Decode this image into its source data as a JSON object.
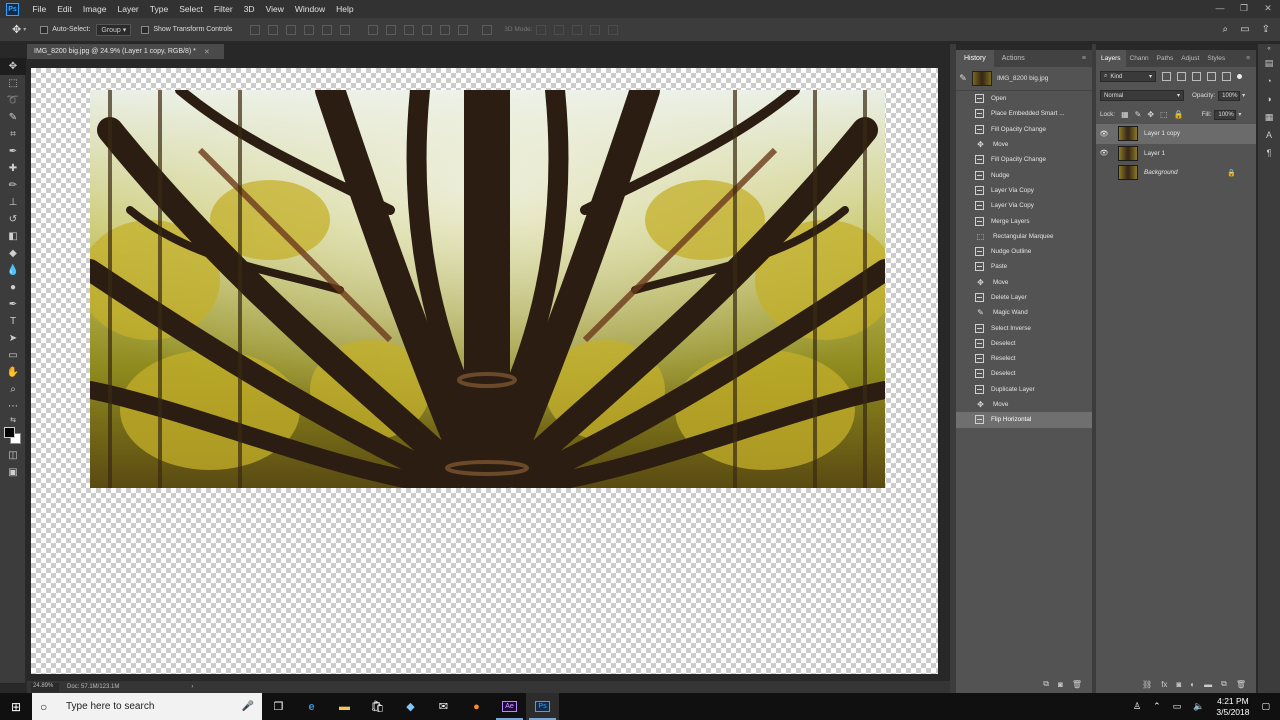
{
  "menubar": {
    "logo": "Ps",
    "items": [
      "File",
      "Edit",
      "Image",
      "Layer",
      "Type",
      "Select",
      "Filter",
      "3D",
      "View",
      "Window",
      "Help"
    ],
    "window_buttons": [
      "—",
      "❐",
      "✕"
    ]
  },
  "options_bar": {
    "auto_select_label": "Auto-Select:",
    "auto_select_target": "Group",
    "show_transform_label": "Show Transform Controls",
    "mode_3d_label": "3D Mode:"
  },
  "document": {
    "tab_title": "IMG_8200 big.jpg @ 24.9% (Layer 1 copy, RGB/8) *",
    "tab_close": "✕",
    "zoom": "24.89%",
    "doc_info": "Doc: 57.1M/123.1M",
    "status_arrow": "›"
  },
  "history_panel": {
    "tabs": [
      "History",
      "Actions"
    ],
    "menu_icon": "≡",
    "snapshot_name": "IMG_8200 big.jpg",
    "states": [
      {
        "label": "Open",
        "icon": "doc"
      },
      {
        "label": "Place Embedded Smart ...",
        "icon": "doc"
      },
      {
        "label": "Fill Opacity Change",
        "icon": "doc"
      },
      {
        "label": "Move",
        "icon": "move"
      },
      {
        "label": "Fill Opacity Change",
        "icon": "doc"
      },
      {
        "label": "Nudge",
        "icon": "doc"
      },
      {
        "label": "Layer Via Copy",
        "icon": "doc"
      },
      {
        "label": "Layer Via Copy",
        "icon": "doc"
      },
      {
        "label": "Merge Layers",
        "icon": "doc"
      },
      {
        "label": "Rectangular Marquee",
        "icon": "marquee"
      },
      {
        "label": "Nudge Outline",
        "icon": "doc"
      },
      {
        "label": "Paste",
        "icon": "doc"
      },
      {
        "label": "Move",
        "icon": "move"
      },
      {
        "label": "Delete Layer",
        "icon": "doc"
      },
      {
        "label": "Magic Wand",
        "icon": "wand"
      },
      {
        "label": "Select Inverse",
        "icon": "doc"
      },
      {
        "label": "Deselect",
        "icon": "doc"
      },
      {
        "label": "Reselect",
        "icon": "doc"
      },
      {
        "label": "Deselect",
        "icon": "doc"
      },
      {
        "label": "Duplicate Layer",
        "icon": "doc"
      },
      {
        "label": "Move",
        "icon": "move"
      },
      {
        "label": "Flip Horizontal",
        "icon": "doc"
      }
    ],
    "selected_index": 21
  },
  "layers_panel": {
    "tabs": [
      "Layers",
      "Chann",
      "Paths",
      "Adjust",
      "Styles"
    ],
    "menu_icon": "≡",
    "filter_kind": "Kind",
    "blend_mode": "Normal",
    "opacity_label": "Opacity:",
    "opacity_value": "100%",
    "lock_label": "Lock:",
    "fill_label": "Fill:",
    "fill_value": "100%",
    "layers": [
      {
        "name": "Layer 1 copy",
        "visible": true,
        "selected": true,
        "italic": false,
        "locked": false
      },
      {
        "name": "Layer 1",
        "visible": true,
        "selected": false,
        "italic": false,
        "locked": false
      },
      {
        "name": "Background",
        "visible": false,
        "selected": false,
        "italic": true,
        "locked": true
      }
    ]
  },
  "taskbar": {
    "search_placeholder": "Type here to search",
    "time": "4:21 PM",
    "date": "3/5/2018",
    "apps": [
      "task-view",
      "edge",
      "file-explorer",
      "store",
      "app",
      "mail",
      "firefox",
      "after-effects",
      "photoshop"
    ],
    "ae_label": "Ae",
    "ps_label": "Ps"
  },
  "colors": {
    "panel_bg": "#535353",
    "dark_bg": "#282828",
    "accent": "#31a8ff"
  }
}
